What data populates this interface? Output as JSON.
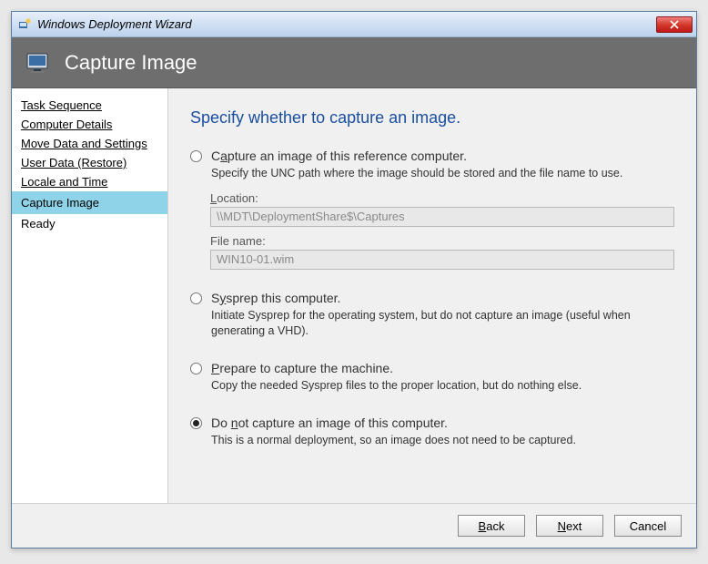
{
  "window": {
    "title": "Windows Deployment Wizard"
  },
  "header": {
    "title": "Capture Image"
  },
  "sidebar": {
    "items": [
      {
        "label": "Task Sequence",
        "active": false,
        "link": true
      },
      {
        "label": "Computer Details",
        "active": false,
        "link": true
      },
      {
        "label": "Move Data and Settings",
        "active": false,
        "link": true
      },
      {
        "label": "User Data (Restore)",
        "active": false,
        "link": true
      },
      {
        "label": "Locale and Time",
        "active": false,
        "link": true
      },
      {
        "label": "Capture Image",
        "active": true,
        "link": false
      },
      {
        "label": "Ready",
        "active": false,
        "link": false
      }
    ]
  },
  "main": {
    "heading": "Specify whether to capture an image.",
    "options": [
      {
        "id": "capture",
        "label_pre": "C",
        "label_ul": "a",
        "label_post": "pture an image of this reference computer.",
        "desc": "Specify the UNC path where the image should be stored and the file name to use.",
        "checked": false
      },
      {
        "id": "sysprep",
        "label_pre": "S",
        "label_ul": "y",
        "label_post": "sprep this computer.",
        "desc": "Initiate Sysprep for the operating system, but do not capture an image (useful when generating a VHD).",
        "checked": false
      },
      {
        "id": "prepare",
        "label_pre": "",
        "label_ul": "P",
        "label_post": "repare to capture the machine.",
        "desc": "Copy the needed Sysprep files to the proper location, but do nothing else.",
        "checked": false
      },
      {
        "id": "donot",
        "label_pre": "Do ",
        "label_ul": "n",
        "label_post": "ot capture an image of this computer.",
        "desc": "This is a normal deployment, so an image does not need to be captured.",
        "checked": true
      }
    ],
    "fields": {
      "location_label_ul": "L",
      "location_label_post": "ocation:",
      "location_value": "\\\\MDT\\DeploymentShare$\\Captures",
      "filename_label": "File name:",
      "filename_value": "WIN10-01.wim"
    }
  },
  "footer": {
    "back_ul": "B",
    "back_post": "ack",
    "next_ul": "N",
    "next_post": "ext",
    "cancel": "Cancel"
  }
}
